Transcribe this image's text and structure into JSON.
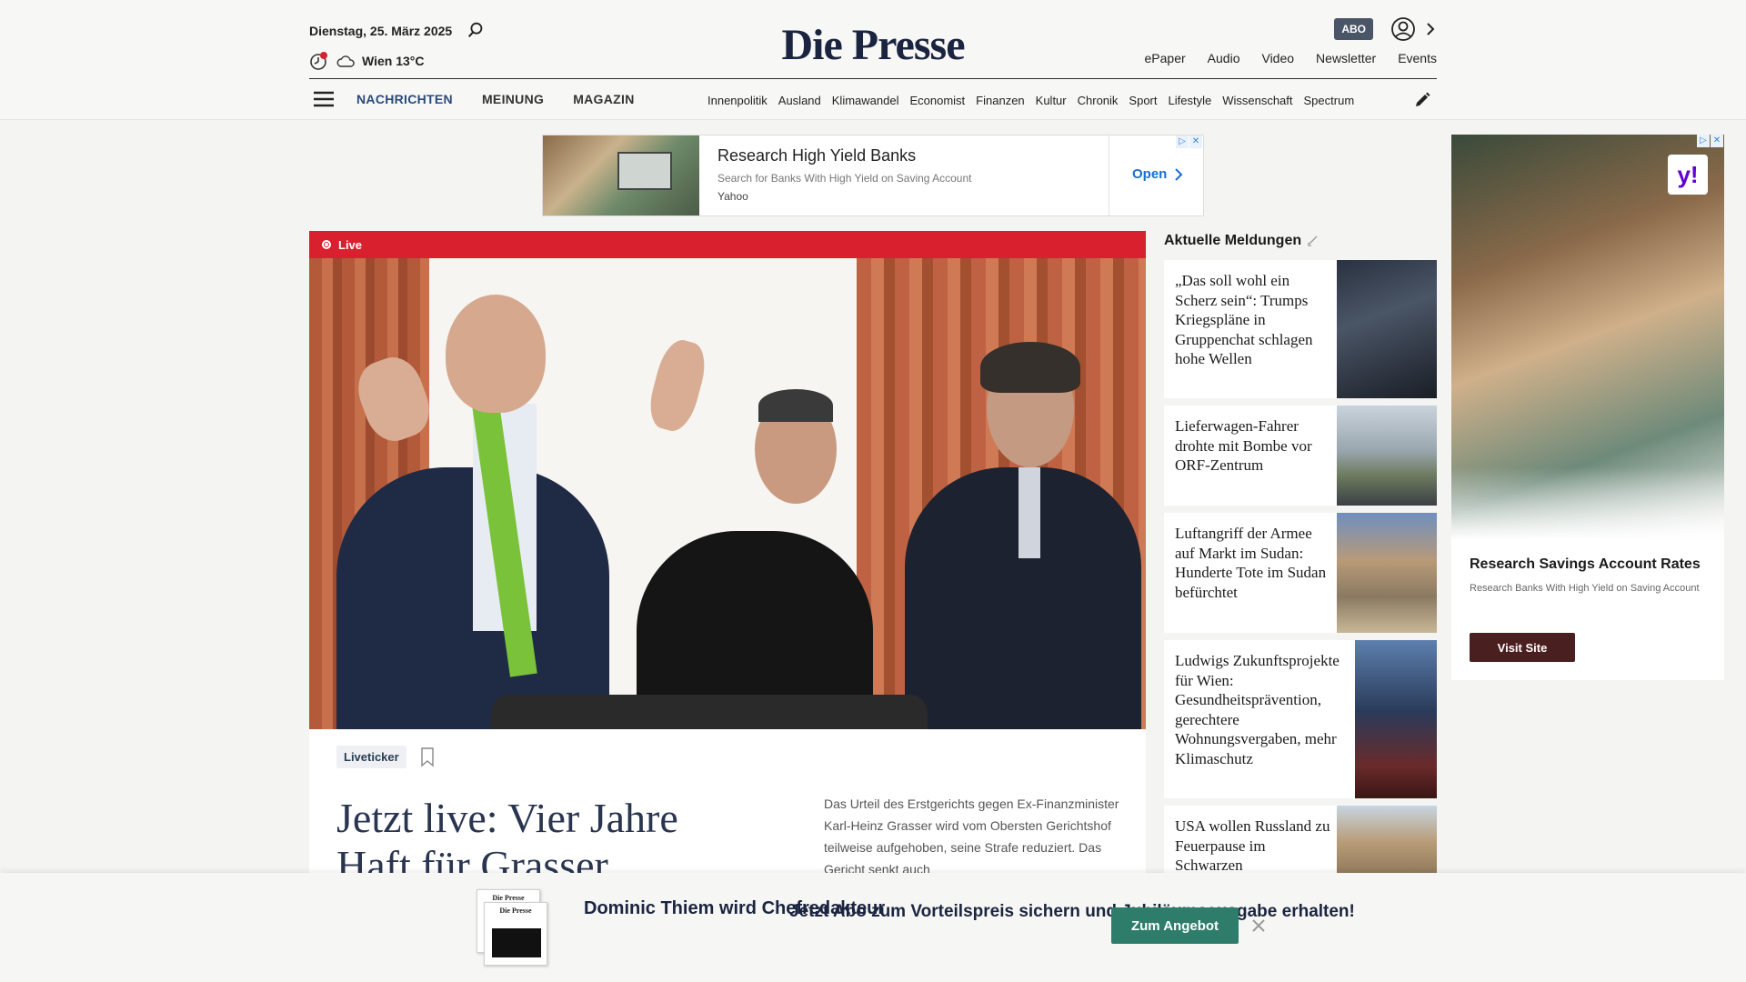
{
  "header": {
    "date": "Dienstag, 25. März 2025",
    "weather": "Wien 13°C",
    "logo": "Die Presse",
    "abo": "ABO",
    "service_nav": [
      "ePaper",
      "Audio",
      "Video",
      "Newsletter",
      "Events"
    ]
  },
  "main_nav": [
    "NACHRICHTEN",
    "MEINUNG",
    "MAGAZIN"
  ],
  "sub_nav": [
    "Innenpolitik",
    "Ausland",
    "Klimawandel",
    "Economist",
    "Finanzen",
    "Kultur",
    "Chronik",
    "Sport",
    "Lifestyle",
    "Wissenschaft",
    "Spectrum"
  ],
  "top_ad": {
    "title": "Research High Yield Banks",
    "subtitle": "Search for Banks With High Yield on Saving Account",
    "brand": "Yahoo",
    "open": "Open"
  },
  "lead": {
    "live": "Live",
    "chip": "Liveticker",
    "headline": "Jetzt live: Vier Jahre Haft für Grasser",
    "text": "Das Urteil des Erstgerichts gegen Ex-Finanzminister Karl-Heinz Grasser wird vom Obersten Gerichtshof teilweise aufgehoben, seine Strafe reduziert. Das Gericht senkt auch"
  },
  "news": {
    "title": "Aktuelle Meldungen",
    "items": [
      "„Das soll wohl ein Scherz sein“: Trumps Kriegspläne in Gruppenchat schlagen hohe Wellen",
      "Lieferwagen-Fahrer drohte mit Bombe vor ORF-Zentrum",
      "Luftangriff der Armee auf Markt im Sudan: Hunderte Tote im Sudan befürchtet",
      "Ludwigs Zukunftsprojekte für Wien: Gesundheitsprävention, gerechtere Wohnungsvergaben, mehr Klimaschutz",
      "USA wollen Russland zu Feuerpause im Schwarzen"
    ]
  },
  "side_ad": {
    "title": "Research Savings Account Rates",
    "subtitle": "Research Banks With High Yield on Saving Account",
    "button": "Visit Site",
    "logo": "y!"
  },
  "promo": {
    "name": "Dominic Thiem wird Chefredakteur",
    "text": "Jetzt Abo zum Vorteilspreis sichern und Jubiläumsausgabe erhalten!",
    "button": "Zum Angebot",
    "paper_mast": "Die Presse"
  },
  "colors": {
    "live_red": "#d8202f",
    "nav_active": "#2a4a7a",
    "promo_button": "#2e7d6b",
    "logo": "#1a2440"
  }
}
